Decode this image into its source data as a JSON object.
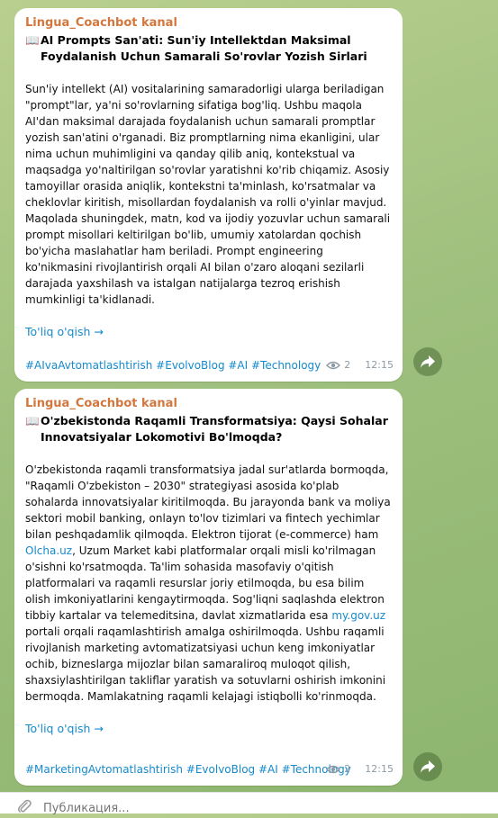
{
  "messages": [
    {
      "channel": "Lingua_Coachbot kanal",
      "title": "AI Prompts San'ati: Sun'iy Intellektdan Maksimal Foydalanish Uchun Samarali So'rovlar Yozish Sirlari",
      "body": "Sun'iy intellekt (AI) vositalarining samaradorligi ularga beriladigan \"prompt\"lar, ya'ni so'rovlarning sifatiga bog'liq. Ushbu maqola AI'dan maksimal darajada foydalanish uchun samarali promptlar yozish san'atini o'rganadi. Biz promptlarning nima ekanligini, ular nima uchun muhimligini va qanday qilib aniq, kontekstual va maqsadga yo'naltirilgan so'rovlar yaratishni ko'rib chiqamiz. Asosiy tamoyillar orasida aniqlik, kontekstni ta'minlash, ko'rsatmalar va cheklovlar kiritish, misollardan foydalanish va rolli o'yinlar mavjud. Maqolada shuningdek, matn, kod va ijodiy yozuvlar uchun samarali prompt misollari keltirilgan bo'lib, umumiy xatolardan qochish bo'yicha maslahatlar ham beriladi. Prompt engineering ko'nikmasini rivojlantirish orqali AI bilan o'zaro aloqani sezilarli darajada yaxshilash va istalgan natijalarga tezroq erishish mumkinligi ta'kidlanadi.",
      "read_more": "To'liq o'qish →",
      "tags": "#AIvaAvtomatlashtirish #EvolvoBlog #AI #Technology",
      "views": "2",
      "time": "12:15"
    },
    {
      "channel": "Lingua_Coachbot kanal",
      "title": "O'zbekistonda Raqamli Transformatsiya: Qaysi Sohalar Innovatsiyalar Lokomotivi Bo'lmoqda?",
      "body_part1": "O'zbekistonda raqamli transformatsiya jadal sur'atlarda bormoqda, \"Raqamli O'zbekiston – 2030\" strategiyasi asosida ko'plab sohalarda innovatsiyalar kiritilmoqda. Bu jarayonda bank va moliya sektori mobil banking, onlayn to'lov tizimlari va fintech yechimlar bilan peshqadamlik qilmoqda. Elektron tijorat (e-commerce) ham ",
      "link1": "Olcha.uz",
      "body_part2": ", Uzum Market kabi platformalar orqali misli ko'rilmagan o'sishni ko'rsatmoqda. Ta'lim sohasida masofaviy o'qitish platformalari va raqamli resurslar joriy etilmoqda, bu esa bilim olish imkoniyatlarini kengaytirmoqda. Sog'liqni saqlashda elektron tibbiy kartalar va telemeditsina, davlat xizmatlarida esa ",
      "link2": "my.gov.uz",
      "body_part3": " portali orqali raqamlashtirish amalga oshirilmoqda. Ushbu raqamli rivojlanish marketing avtomatizatsiyasi uchun keng imkoniyatlar ochib, bizneslarga mijozlar bilan samaraliroq muloqot qilish, shaxsiylashtirilgan takliflar yaratish va sotuvlarni oshirish imkonini bermoqda. Mamlakatning raqamli kelajagi istiqbolli ko'rinmoqda.",
      "read_more": "To'liq o'qish →",
      "tags": "#MarketingAvtomatlashtirish #EvolvoBlog #AI #Technology",
      "views": "2",
      "time": "12:15"
    }
  ],
  "composer": {
    "placeholder": "Публикация..."
  },
  "icons": {
    "title_icon": "📖",
    "eye": "eye-icon",
    "share": "share-arrow-icon",
    "attach": "paperclip-icon"
  },
  "colors": {
    "channel": "#d2773e",
    "link": "#168acd",
    "meta": "#8e9aa4"
  }
}
